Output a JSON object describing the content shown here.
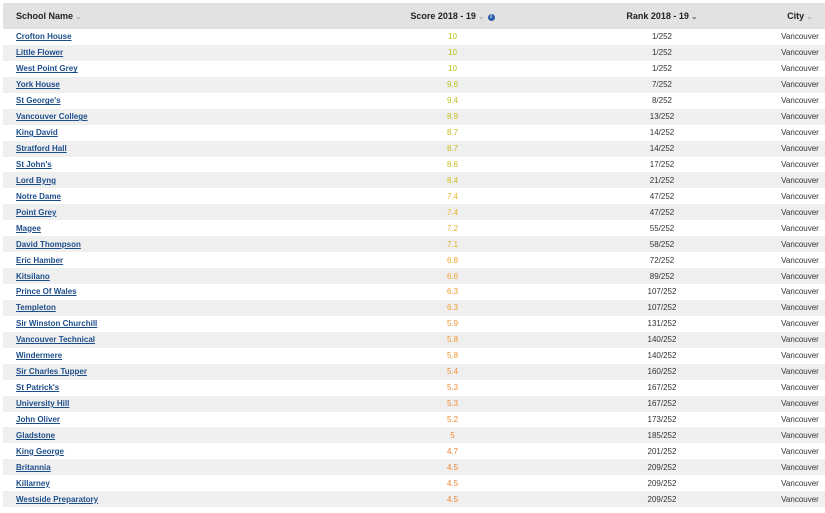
{
  "table": {
    "headers": {
      "name": "School Name",
      "score": "Score 2018 - 19",
      "rank": "Rank 2018 - 19",
      "city": "City"
    },
    "rows": [
      {
        "name": "Crofton House",
        "score": "10",
        "rank": "1/252",
        "city": "Vancouver",
        "score_color": "#b5bf16"
      },
      {
        "name": "Little Flower",
        "score": "10",
        "rank": "1/252",
        "city": "Vancouver",
        "score_color": "#b5bf16"
      },
      {
        "name": "West Point Grey",
        "score": "10",
        "rank": "1/252",
        "city": "Vancouver",
        "score_color": "#b5bf16"
      },
      {
        "name": "York House",
        "score": "9.6",
        "rank": "7/252",
        "city": "Vancouver",
        "score_color": "#bcbf16"
      },
      {
        "name": "St George's",
        "score": "9.4",
        "rank": "8/252",
        "city": "Vancouver",
        "score_color": "#bfbd18"
      },
      {
        "name": "Vancouver College",
        "score": "8.9",
        "rank": "13/252",
        "city": "Vancouver",
        "score_color": "#c4bc1a"
      },
      {
        "name": "King David",
        "score": "8.7",
        "rank": "14/252",
        "city": "Vancouver",
        "score_color": "#c9bb1b"
      },
      {
        "name": "Stratford Hall",
        "score": "8.7",
        "rank": "14/252",
        "city": "Vancouver",
        "score_color": "#c9bb1b"
      },
      {
        "name": "St John's",
        "score": "8.6",
        "rank": "17/252",
        "city": "Vancouver",
        "score_color": "#cbba1c"
      },
      {
        "name": "Lord Byng",
        "score": "8.4",
        "rank": "21/252",
        "city": "Vancouver",
        "score_color": "#cfb91d"
      },
      {
        "name": "Notre Dame",
        "score": "7.4",
        "rank": "47/252",
        "city": "Vancouver",
        "score_color": "#e6b627"
      },
      {
        "name": "Point Grey",
        "score": "7.4",
        "rank": "47/252",
        "city": "Vancouver",
        "score_color": "#e6b627"
      },
      {
        "name": "Magee",
        "score": "7.2",
        "rank": "55/252",
        "city": "Vancouver",
        "score_color": "#e9b129"
      },
      {
        "name": "David Thompson",
        "score": "7.1",
        "rank": "58/252",
        "city": "Vancouver",
        "score_color": "#ebad2a"
      },
      {
        "name": "Eric Hamber",
        "score": "6.8",
        "rank": "72/252",
        "city": "Vancouver",
        "score_color": "#eda62b"
      },
      {
        "name": "Kitsilano",
        "score": "6.6",
        "rank": "89/252",
        "city": "Vancouver",
        "score_color": "#eea22c"
      },
      {
        "name": "Prince Of Wales",
        "score": "6.3",
        "rank": "107/252",
        "city": "Vancouver",
        "score_color": "#ef9c2d"
      },
      {
        "name": "Templeton",
        "score": "6.3",
        "rank": "107/252",
        "city": "Vancouver",
        "score_color": "#ef9c2d"
      },
      {
        "name": "Sir Winston Churchill",
        "score": "5.9",
        "rank": "131/252",
        "city": "Vancouver",
        "score_color": "#f0962e"
      },
      {
        "name": "Vancouver Technical",
        "score": "5.8",
        "rank": "140/252",
        "city": "Vancouver",
        "score_color": "#f0942e"
      },
      {
        "name": "Windermere",
        "score": "5.8",
        "rank": "140/252",
        "city": "Vancouver",
        "score_color": "#f0942e"
      },
      {
        "name": "Sir Charles Tupper",
        "score": "5.4",
        "rank": "160/252",
        "city": "Vancouver",
        "score_color": "#f08e2f"
      },
      {
        "name": "St Patrick's",
        "score": "5.3",
        "rank": "167/252",
        "city": "Vancouver",
        "score_color": "#f08c2f"
      },
      {
        "name": "University Hill",
        "score": "5.3",
        "rank": "167/252",
        "city": "Vancouver",
        "score_color": "#f08c2f"
      },
      {
        "name": "John Oliver",
        "score": "5.2",
        "rank": "173/252",
        "city": "Vancouver",
        "score_color": "#f08a2f"
      },
      {
        "name": "Gladstone",
        "score": "5",
        "rank": "185/252",
        "city": "Vancouver",
        "score_color": "#f08730"
      },
      {
        "name": "King George",
        "score": "4.7",
        "rank": "201/252",
        "city": "Vancouver",
        "score_color": "#ef8230"
      },
      {
        "name": "Britannia",
        "score": "4.5",
        "rank": "209/252",
        "city": "Vancouver",
        "score_color": "#ef7f30"
      },
      {
        "name": "Killarney",
        "score": "4.5",
        "rank": "209/252",
        "city": "Vancouver",
        "score_color": "#ef7f30"
      },
      {
        "name": "Westside Preparatory",
        "score": "4.5",
        "rank": "209/252",
        "city": "Vancouver",
        "score_color": "#ef7f30"
      }
    ]
  }
}
